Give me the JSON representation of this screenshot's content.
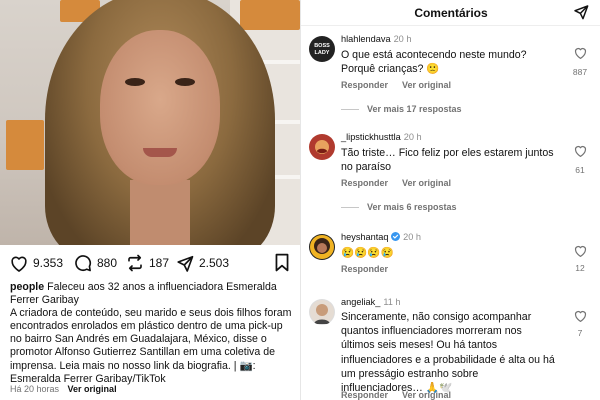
{
  "post": {
    "likes": "9.353",
    "comments": "880",
    "reposts": "187",
    "shares": "2.503",
    "caption_user": "people",
    "caption_text": "Faleceu aos 32 anos a influenciadora Esmeralda Ferrer Garibay",
    "caption_body": "A criadora de conteúdo, seu marido e seus dois filhos foram encontrados enrolados em plástico dentro de uma pick-up no bairro San Andrés em Guadalajara, México, disse o promotor Alfonso Gutierrez Santillan em uma coletiva de imprensa. Leia mais no nosso link da biografia. | 📷: Esmeralda Ferrer Garibay/TikTok",
    "time_ago": "Há 20 horas",
    "see_original": "Ver original"
  },
  "comments_panel": {
    "title": "Comentários",
    "items": [
      {
        "username": "hlahlendava",
        "time": "20 h",
        "text": "O que está acontecendo neste mundo? Porquê crianças? 🙁",
        "like_count": "887",
        "reply_label": "Responder",
        "see_original": "Ver original",
        "more_replies": "Ver mais 17 respostas"
      },
      {
        "username": "_lipstickhusttla",
        "time": "20 h",
        "text": "Tão triste… Fico feliz por eles estarem juntos no paraíso",
        "like_count": "61",
        "reply_label": "Responder",
        "see_original": "Ver original",
        "more_replies": "Ver mais 6 respostas"
      },
      {
        "username": "heyshantaq",
        "time": "20 h",
        "text": "😢😢😢😢",
        "like_count": "12",
        "reply_label": "Responder",
        "see_original": ""
      },
      {
        "username": "angeliak_",
        "time": "11 h",
        "text": "Sinceramente, não consigo acompanhar quantos influenciadores morreram nos últimos seis meses! Ou há tantos influenciadores e a probabilidade é alta ou há um presságio estranho sobre influenciadores… 🙏🕊️",
        "like_count": "7",
        "reply_label": "Responder",
        "see_original": "Ver original"
      }
    ]
  },
  "colors": {
    "verified": "#3897f0",
    "muted": "#737373"
  }
}
